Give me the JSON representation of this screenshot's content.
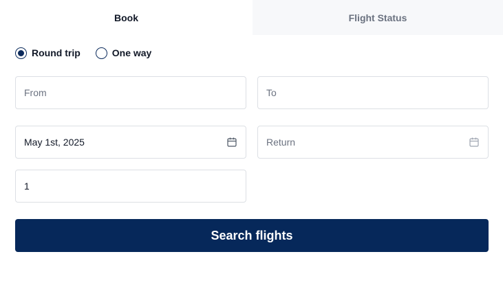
{
  "tabs": [
    {
      "label": "Book",
      "active": true
    },
    {
      "label": "Flight Status",
      "active": false
    }
  ],
  "trip_type": {
    "options": [
      {
        "label": "Round trip",
        "selected": true
      },
      {
        "label": "One way",
        "selected": false
      }
    ]
  },
  "form": {
    "from": {
      "placeholder": "From",
      "value": ""
    },
    "to": {
      "placeholder": "To",
      "value": ""
    },
    "depart": {
      "value": "May 1st, 2025",
      "icon": "calendar-icon"
    },
    "return": {
      "placeholder": "Return",
      "value": "",
      "icon": "calendar-icon"
    },
    "passengers": {
      "value": "1"
    }
  },
  "search_button": {
    "label": "Search flights"
  },
  "colors": {
    "primary": "#06285a",
    "inactive_tab_bg": "#f7f8fa",
    "border": "#dcdfe4",
    "placeholder": "#6b7280"
  }
}
